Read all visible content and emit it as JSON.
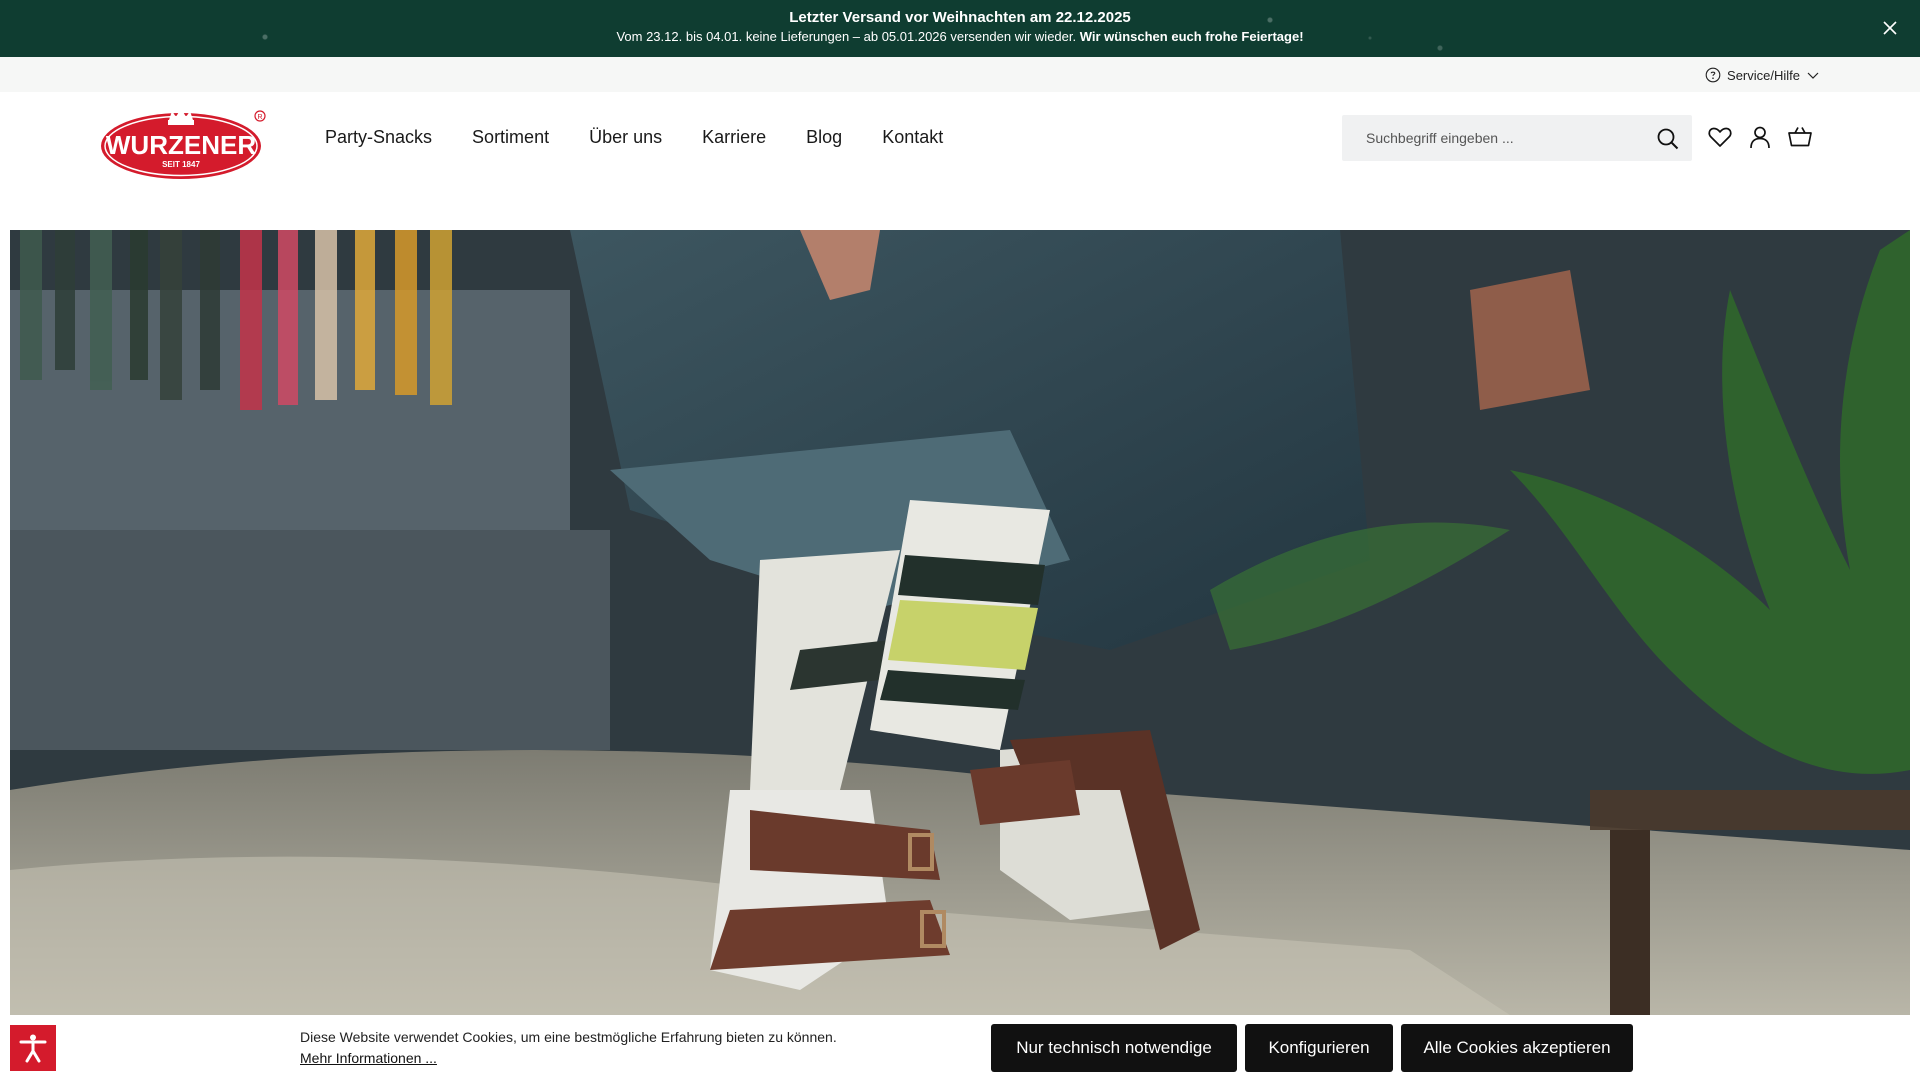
{
  "announcement": {
    "title": "Letzter Versand vor Weihnachten am 22.12.2025",
    "text": "Vom 23.12. bis 04.01. keine Lieferungen – ab 05.01.2026 versenden wir wieder. ",
    "text_bold": "Wir wünschen euch frohe Feiertage!",
    "close_icon": "close-icon",
    "background": "#0f3d31"
  },
  "service": {
    "label": "Service/Hilfe",
    "icon": "help-circle-icon"
  },
  "brand": {
    "name": "WURZENER",
    "tagline": "SEIT 1847",
    "color": "#d41b2c"
  },
  "nav": {
    "items": [
      "Party-Snacks",
      "Sortiment",
      "Über uns",
      "Karriere",
      "Blog",
      "Kontakt"
    ]
  },
  "search": {
    "placeholder": "Suchbegriff eingeben ...",
    "icon": "search-icon"
  },
  "header_icons": [
    "heart-icon",
    "user-icon",
    "basket-icon"
  ],
  "cookie": {
    "text": "Diese Website verwendet Cookies, um eine bestmögliche Erfahrung bieten zu können.",
    "more_link": "Mehr Informationen ...",
    "btn_necessary": "Nur technisch notwendige",
    "btn_configure": "Konfigurieren",
    "btn_accept_all": "Alle Cookies akzeptieren",
    "accessibility_icon": "accessibility-icon"
  }
}
